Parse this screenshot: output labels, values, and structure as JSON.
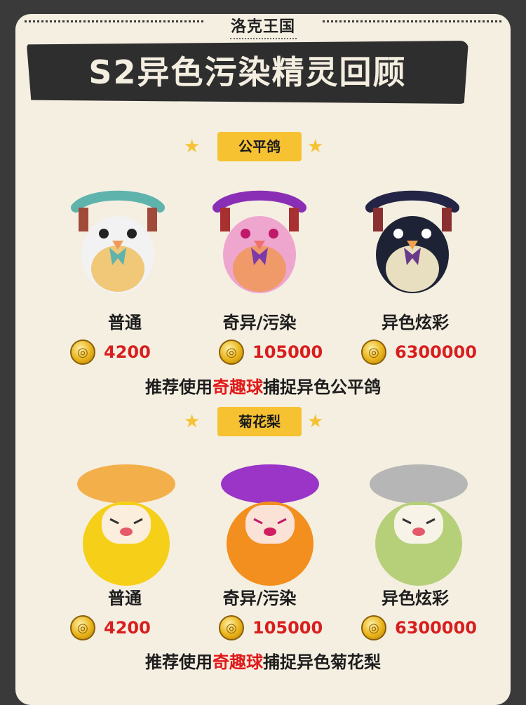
{
  "header": {
    "logo_text": "洛克王国",
    "title": "S2异色污染精灵回顾"
  },
  "colors": {
    "accent": "#f6c232",
    "price": "#d81e1e",
    "highlight": "#e01919",
    "banner": "#2e2e2e",
    "background": "#f5efe2"
  },
  "sections": [
    {
      "name": "公平鸽",
      "variants": [
        {
          "label": "普通",
          "price": "4200"
        },
        {
          "label": "奇异/污染",
          "price": "105000"
        },
        {
          "label": "异色炫彩",
          "price": "6300000"
        }
      ],
      "rec_prefix": "推荐使用",
      "rec_highlight": "奇趣球",
      "rec_suffix": "捕捉异色公平鸽"
    },
    {
      "name": "菊花梨",
      "variants": [
        {
          "label": "普通",
          "price": "4200"
        },
        {
          "label": "奇异/污染",
          "price": "105000"
        },
        {
          "label": "异色炫彩",
          "price": "6300000"
        }
      ],
      "rec_prefix": "推荐使用",
      "rec_highlight": "奇趣球",
      "rec_suffix": "捕捉异色菊花梨"
    }
  ],
  "icons": [
    "star-icon",
    "coin-icon"
  ]
}
